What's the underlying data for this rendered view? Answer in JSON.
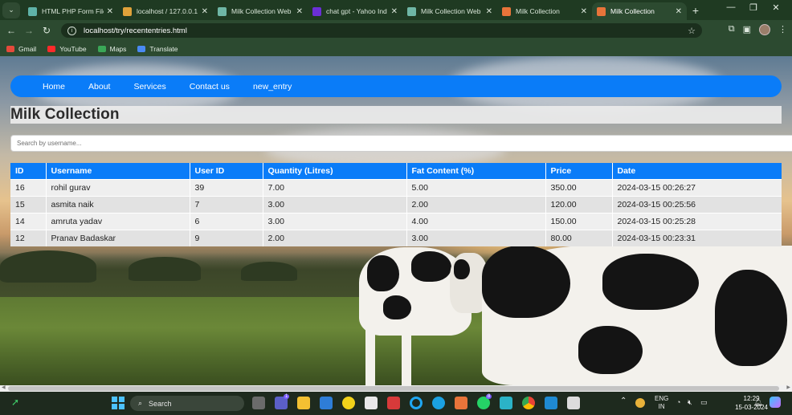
{
  "browser": {
    "tabs": [
      {
        "title": "HTML PHP Form File",
        "icon_color": "#5fb3a8",
        "active": false
      },
      {
        "title": "localhost / 127.0.0.1",
        "icon_color": "#e0a23a",
        "active": false
      },
      {
        "title": "Milk Collection Web",
        "icon_color": "#6fb7a6",
        "active": false
      },
      {
        "title": "chat gpt - Yahoo Ind",
        "icon_color": "#6b2fd6",
        "active": false
      },
      {
        "title": "Milk Collection Web",
        "icon_color": "#6fb7a6",
        "active": false
      },
      {
        "title": "Milk Collection",
        "icon_color": "#e8743a",
        "active": false
      },
      {
        "title": "Milk Collection",
        "icon_color": "#e8743a",
        "active": true
      }
    ],
    "tab_close_glyph": "✕",
    "new_tab_glyph": "+",
    "window_controls": {
      "minimize": "—",
      "restore": "❐",
      "close": "✕"
    },
    "address": "localhost/try/recententries.html",
    "bookmarks": [
      {
        "label": "Gmail",
        "icon_color": "#e64a3b"
      },
      {
        "label": "YouTube",
        "icon_color": "#ff2a2a"
      },
      {
        "label": "Maps",
        "icon_color": "#3aa757"
      },
      {
        "label": "Translate",
        "icon_color": "#4a8af4"
      }
    ]
  },
  "page": {
    "nav": [
      "Home",
      "About",
      "Services",
      "Contact us",
      "new_entry"
    ],
    "title": "Milk Collection",
    "search_placeholder": "Search by username...",
    "table": {
      "headers": [
        "ID",
        "Username",
        "User ID",
        "Quantity (Litres)",
        "Fat Content (%)",
        "Price",
        "Date"
      ],
      "rows": [
        [
          "16",
          "rohil gurav",
          "39",
          "7.00",
          "5.00",
          "350.00",
          "2024-03-15 00:26:27"
        ],
        [
          "15",
          "asmita naik",
          "7",
          "3.00",
          "2.00",
          "120.00",
          "2024-03-15 00:25:56"
        ],
        [
          "14",
          "amruta yadav",
          "6",
          "3.00",
          "4.00",
          "150.00",
          "2024-03-15 00:25:28"
        ],
        [
          "12",
          "Pranav Badaskar",
          "9",
          "2.00",
          "3.00",
          "80.00",
          "2024-03-15 00:23:31"
        ]
      ]
    },
    "colors": {
      "accent": "#0a7cf8"
    }
  },
  "taskbar": {
    "search_label": "Search",
    "language": "ENG",
    "region": "IN",
    "time": "12:29",
    "date": "15-03-2024",
    "badges": {
      "teams": "1",
      "whatsapp": "8"
    }
  }
}
